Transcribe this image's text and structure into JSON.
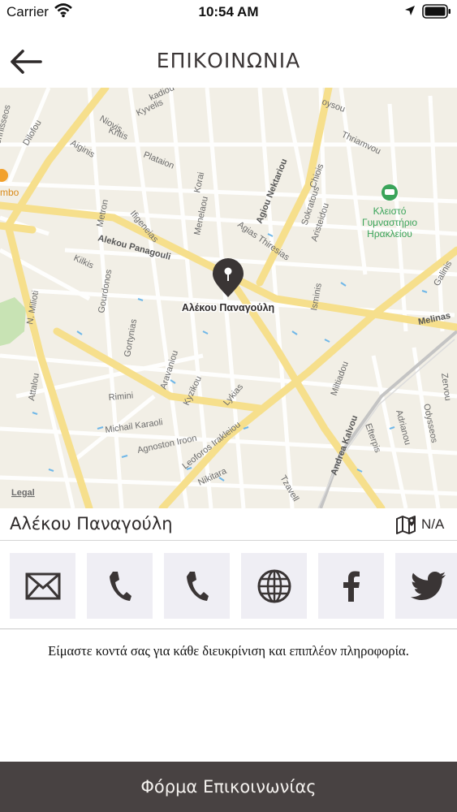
{
  "status_bar": {
    "carrier": "Carrier",
    "time": "10:54 AM"
  },
  "nav": {
    "title": "ΕΠΙΚΟΙΝΩΝΙΑ"
  },
  "map": {
    "pin_label": "Αλέκου Παναγούλη",
    "legal": "Legal",
    "poi": {
      "line1": "Κλειστό",
      "line2": "Γυμναστήριο",
      "line3": "Ηρακλείου",
      "color": "#3aa45a"
    },
    "poi_left": "mbo",
    "streets": {
      "kadiou": "kadiou",
      "kyvelis": "Kyvelis",
      "dilofou": "Dilofou",
      "niovis": "Niovis",
      "kritis": "Kritis",
      "aiginis": "Aiginis",
      "plataion": "Plataion",
      "gennisseos": "ennisseos",
      "thriamvou": "Thriamvou",
      "oysou": "oysou",
      "agiou_nektariou": "Agiou Nektariou",
      "chiois": "Chiois",
      "korai": "Korai",
      "menelaou": "Menelaou",
      "sokratous": "Sokratous",
      "aristeidou": "Aristeidou",
      "metron": "Metron",
      "ifigeneias": "Ifigeneias",
      "agias_thiresias": "Agias Thiresias",
      "alekou_panagouli": "Alekou Panagouli",
      "kilkis": "Kilkis",
      "gourdonos": "Gourdonos",
      "n_milioti": "N. Milioti",
      "isminis": "Isminis",
      "galinis": "Galinis",
      "melinas": "Melinas",
      "gortynias": "Gortynias",
      "aravaniou": "Aravaniou",
      "kyzikou": "Kyzikou",
      "lykias": "Lykias",
      "rimini": "Rimini",
      "attalou": "Attalou",
      "michail_karaoli": "Michail Karaoli",
      "agnoston_iroon": "Agnoston Iroon",
      "leoforos_irakleiou": "Leoforos Irakleiou",
      "nikitara": "Nikitara",
      "miltiadou": "Miltiadou",
      "andrea_kalvou": "Andrea Kalvou",
      "efterpis": "Efterpis",
      "adrianou": "Adrianou",
      "odysseos": "Odysseos",
      "zervou": "Zervou",
      "tzavell": "Tzavell"
    }
  },
  "address": {
    "text": "Αλέκου Παναγούλη",
    "na": "N/A"
  },
  "contact_icons": [
    "mail-icon",
    "phone-icon",
    "phone-icon",
    "globe-icon",
    "facebook-icon",
    "twitter-icon"
  ],
  "description": "Είμαστε κοντά σας για κάθε διευκρίνιση και επιπλέον πληροφορία.",
  "footer": {
    "button_label": "Φόρμα Επικοινωνίας"
  },
  "colors": {
    "footer_bg": "#484242",
    "tile_bg": "#efeef4",
    "icon": "#3a3535",
    "major_road": "#f6df8c"
  }
}
